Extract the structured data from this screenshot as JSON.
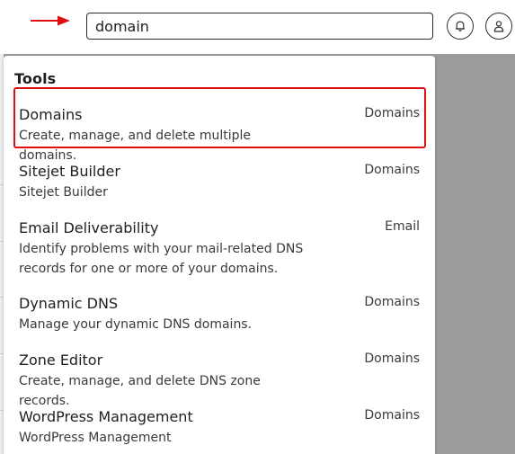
{
  "search": {
    "value": "domain"
  },
  "icons": {
    "arrow": "right-arrow-icon",
    "bell": "bell-icon",
    "user": "user-icon"
  },
  "colors": {
    "annotation_red": "#e01010",
    "backdrop_gray": "#9b9b9b"
  },
  "dropdown": {
    "section_title": "Tools",
    "items": [
      {
        "name": "Domains",
        "category": "Domains",
        "description": "Create, manage, and delete multiple domains."
      },
      {
        "name": "Sitejet Builder",
        "category": "Domains",
        "description": "Sitejet Builder"
      },
      {
        "name": "Email Deliverability",
        "category": "Email",
        "description": "Identify problems with your mail-related DNS records for one or more of your domains."
      },
      {
        "name": "Dynamic DNS",
        "category": "Domains",
        "description": "Manage your dynamic DNS domains."
      },
      {
        "name": "Zone Editor",
        "category": "Domains",
        "description": "Create, manage, and delete DNS zone records."
      },
      {
        "name": "WordPress Management",
        "category": "Domains",
        "description": "WordPress Management"
      }
    ]
  }
}
